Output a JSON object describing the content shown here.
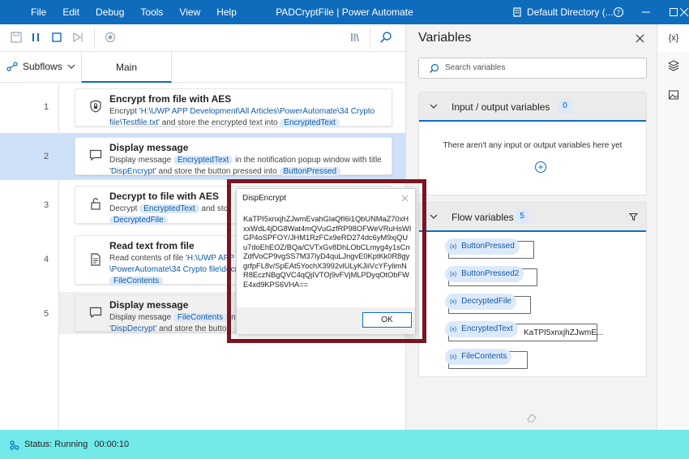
{
  "titlebar": {
    "menu": [
      "File",
      "Edit",
      "Debug",
      "Tools",
      "View",
      "Help"
    ],
    "title": "PADCryptFile | Power Automate",
    "directory": "Default Directory (..."
  },
  "tabs": {
    "subflows": "Subflows",
    "main": "Main"
  },
  "actions": [
    {
      "line": "1",
      "title": "Encrypt from file with AES",
      "d1": "Encrypt ",
      "d2": "'H:\\UWP APP Development\\All Articles\\PowerAutomate\\34 Crypto file\\Testfile.txt'",
      "d3": " and store the encrypted text into ",
      "tok1": "EncryptedText"
    },
    {
      "line": "2",
      "title": "Display message",
      "d1": "Display message ",
      "tok1": "EncryptedText",
      "d2": " in the notification popup window with title ",
      "d3": "'DispEncrypt'",
      "d4": " and store the button pressed into ",
      "tok2": "ButtonPressed"
    },
    {
      "line": "3",
      "title": "Decrypt to file with AES",
      "d1": "Decrypt ",
      "tok1": "EncryptedText",
      "d2": " and stor",
      "tok2": "DecryptedFile"
    },
    {
      "line": "4",
      "title": "Read text from file",
      "d1": "Read contents of file ",
      "d2": "'H:\\UWP APP Devel",
      "d3": "\\PowerAutomate\\34 Crypto file\\decry",
      "tok1": "FileContents"
    },
    {
      "line": "5",
      "title": "Display message",
      "d1": "Display message ",
      "tok1": "FileContents",
      "d2": " in",
      "d3": "'DispDecrypt'",
      "d4": " and store the button"
    }
  ],
  "variables": {
    "title": "Variables",
    "search_placeholder": "Search variables",
    "io": {
      "label": "Input / output variables",
      "count": "0",
      "empty": "There aren't any input or output variables here yet"
    },
    "flow": {
      "label": "Flow variables",
      "count": "5"
    },
    "items": [
      {
        "name": "ButtonPressed",
        "value": ""
      },
      {
        "name": "ButtonPressed2",
        "value": ""
      },
      {
        "name": "DecryptedFile",
        "value": ""
      },
      {
        "name": "EncryptedText",
        "value": "KaTPI5xnxjhZJwmE..."
      },
      {
        "name": "FileContents",
        "value": ""
      }
    ]
  },
  "rail": {
    "variables": "{x}"
  },
  "status": {
    "text": "Status: Running",
    "time": "00:00:10"
  },
  "dialog": {
    "title": "DispEncrypt",
    "message": "KaTPI5xnxjhZJwmEvahGlaQfI6i1QbUNMaZ70xHxxWdL4jDG8Wat4mQVuGzfRP98OFWeVRuHsWIGP4oSPFOY/JHM1RzFCx9eRD274dc6yM9xjQUu7doEhEOZ/BQa/CVTxGv8DhLObCLmyg4y1sCnZdfVoCP9vgSS7M37IyD4quLJngvE0KptKk0R8gygrfpFL8v/SpEAt5YochX3992vlULyKJiiVcYFylimNR8EczNBgQVC4qQjIVTOj9vFVjMLPDyqOtObFWE4xd9KPS6VHA==",
    "ok": "OK"
  }
}
